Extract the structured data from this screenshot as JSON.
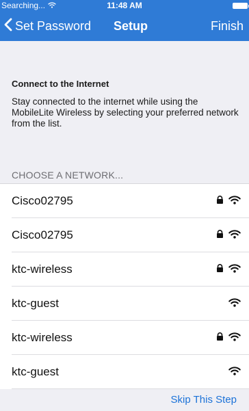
{
  "status_bar": {
    "carrier": "Searching...",
    "time": "11:48 AM"
  },
  "nav": {
    "back_label": "Set Password",
    "title": "Setup",
    "finish_label": "Finish"
  },
  "intro": {
    "heading": "Connect to the Internet",
    "body": "Stay connected to the internet while using the MobileLite Wireless by selecting your preferred network from the list."
  },
  "section_header": "CHOOSE A NETWORK...",
  "networks": [
    {
      "name": "Cisco02795",
      "locked": true
    },
    {
      "name": "Cisco02795",
      "locked": true
    },
    {
      "name": "ktc-wireless",
      "locked": true
    },
    {
      "name": "ktc-guest",
      "locked": false
    },
    {
      "name": "ktc-wireless",
      "locked": true
    },
    {
      "name": "ktc-guest",
      "locked": false
    }
  ],
  "footer": {
    "skip_label": "Skip This Step"
  },
  "colors": {
    "accent": "#2f7bd6",
    "link": "#1b72d8",
    "background": "#efeff4"
  }
}
